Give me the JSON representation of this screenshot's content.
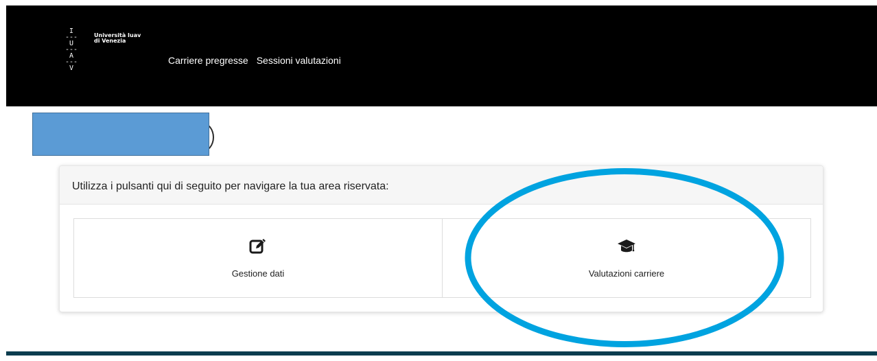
{
  "header": {
    "logo_letters": "I\n---\nU\n---\nA\n---\nV",
    "logo_name_line1": "Università Iuav",
    "logo_name_line2": "di Venezia",
    "nav": {
      "item1": "Carriere pregresse",
      "item2": "Sessioni valutazioni"
    }
  },
  "panel": {
    "header_text": "Utilizza i pulsanti qui di seguito per navigare la tua area riservata:",
    "tiles": {
      "gestione": {
        "label": "Gestione dati",
        "icon": "edit-icon"
      },
      "valutazioni": {
        "label": "Valutazioni carriere",
        "icon": "graduation-cap-icon"
      }
    }
  },
  "colors": {
    "header_bg": "#000000",
    "redaction": "#5b9bd5",
    "highlight": "#00a3e0",
    "footer": "#0b3d4f"
  }
}
